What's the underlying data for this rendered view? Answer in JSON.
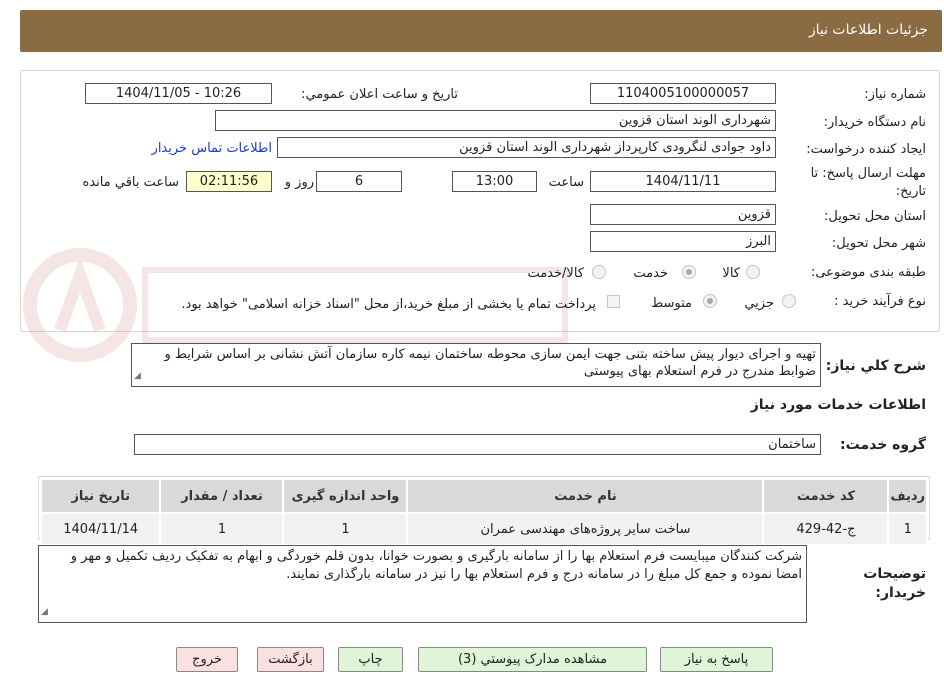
{
  "header": {
    "title": "جزئیات اطلاعات نیاز"
  },
  "fields": {
    "need_number_label": "شماره نیاز:",
    "need_number": "1104005100000057",
    "announce_label": "تاریخ و ساعت اعلان عمومي:",
    "announce_value": "1404/11/05 - 10:26",
    "buyer_org_label": "نام دستگاه خريدار:",
    "buyer_org": "شهرداری الوند استان قزوين",
    "creator_label": "ايجاد کننده درخواست:",
    "creator": "داود جوادی لنگرودی کارپرداز شهرداری الوند استان قزوين",
    "contact_link": "اطلاعات تماس خريدار",
    "deadline_label_line1": "مهلت ارسال پاسخ: تا",
    "deadline_label_line2": "تاريخ:",
    "deadline_date": "1404/11/11",
    "time_label": "ساعت",
    "deadline_time": "13:00",
    "days_value": "6",
    "days_label": "روز و",
    "remaining_value": "02:11:56",
    "remaining_label": "ساعت باقي مانده",
    "province_label": "استان محل تحويل:",
    "province": "قزوين",
    "city_label": "شهر محل تحويل:",
    "city": "البرز",
    "category_label": "طبقه بندی موضوعی:",
    "category_options": [
      "کالا",
      "خدمت",
      "کالا/خدمت"
    ],
    "category_selected": "خدمت",
    "process_label": "نوع فرآيند خريد :",
    "process_options": [
      "جزيي",
      "متوسط"
    ],
    "process_selected": "جزيي",
    "payment_note": "پرداخت تمام يا بخشی از مبلغ خريد،از محل \"اسناد خزانه اسلامی\" خواهد بود."
  },
  "description": {
    "label": "شرح کلي نياز:",
    "text": "تهيه و اجرای ديوار پيش ساخته بتنی جهت ايمن سازی محوطه ساختمان نيمه کاره سازمان آتش نشانی بر اساس شرايط و ضوابط مندرج در فرم استعلام بهای پيوستی"
  },
  "services": {
    "section_title": "اطلاعات خدمات مورد نياز",
    "group_label": "گروه خدمت:",
    "group_value": "ساختمان",
    "columns": [
      "رديف",
      "کد خدمت",
      "نام خدمت",
      "واحد اندازه گيری",
      "تعداد / مقدار",
      "تاريخ نياز"
    ],
    "rows": [
      [
        "1",
        "ج-42-429",
        "ساخت ساير پروژه‌های مهندسی عمران",
        "1",
        "1",
        "1404/11/14"
      ]
    ]
  },
  "buyer_notes": {
    "label_line1": "توضيحات",
    "label_line2": "خريدار:",
    "text": "شرکت کنندگان ميبايست فرم استعلام بها را از سامانه بارگيری و بصورت خوانا، بدون قلم خوردگی و ابهام به تفکيک رديف تکميل و مهر و امضا نموده و جمع کل مبلغ را در سامانه درج و فرم استعلام بها را نيز در سامانه بارگذاری نمايند."
  },
  "buttons": {
    "reply": "پاسخ به نياز",
    "attachments": "مشاهده مدارک پيوستي (3)",
    "print": "چاپ",
    "back": "بازگشت",
    "exit": "خروج"
  },
  "colors": {
    "header_bg": "#8a6b42",
    "remaining_bg": "#ffffcc",
    "link": "#1a3cc8"
  }
}
